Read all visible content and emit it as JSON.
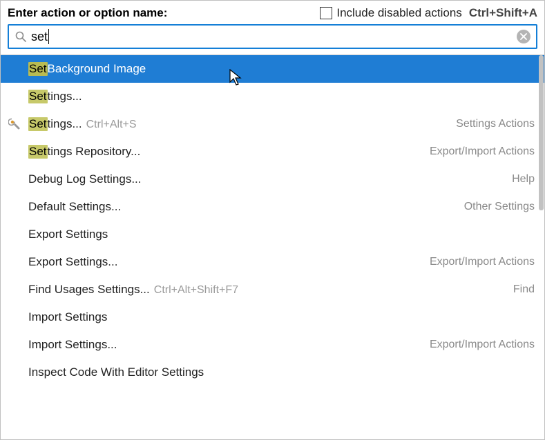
{
  "header": {
    "prompt": "Enter action or option name:",
    "checkbox_label": "Include disabled actions",
    "shortcut": "Ctrl+Shift+A"
  },
  "search": {
    "value": "set"
  },
  "results": [
    {
      "highlight": "Set",
      "rest": " Background Image",
      "shortcut": "",
      "category": "",
      "selected": true,
      "icon": ""
    },
    {
      "highlight": "Set",
      "rest": "tings...",
      "shortcut": "",
      "category": "",
      "selected": false,
      "icon": ""
    },
    {
      "highlight": "Set",
      "rest": "tings...",
      "shortcut": "Ctrl+Alt+S",
      "category": "Settings Actions",
      "selected": false,
      "icon": "wrench"
    },
    {
      "highlight": "Set",
      "rest": "tings Repository...",
      "shortcut": "",
      "category": "Export/Import Actions",
      "selected": false,
      "icon": ""
    },
    {
      "highlight": "",
      "rest": "Debug Log Settings...",
      "shortcut": "",
      "category": "Help",
      "selected": false,
      "icon": ""
    },
    {
      "highlight": "",
      "rest": "Default Settings...",
      "shortcut": "",
      "category": "Other Settings",
      "selected": false,
      "icon": ""
    },
    {
      "highlight": "",
      "rest": "Export Settings",
      "shortcut": "",
      "category": "",
      "selected": false,
      "icon": ""
    },
    {
      "highlight": "",
      "rest": "Export Settings...",
      "shortcut": "",
      "category": "Export/Import Actions",
      "selected": false,
      "icon": ""
    },
    {
      "highlight": "",
      "rest": "Find Usages Settings...",
      "shortcut": "Ctrl+Alt+Shift+F7",
      "category": "Find",
      "selected": false,
      "icon": ""
    },
    {
      "highlight": "",
      "rest": "Import Settings",
      "shortcut": "",
      "category": "",
      "selected": false,
      "icon": ""
    },
    {
      "highlight": "",
      "rest": "Import Settings...",
      "shortcut": "",
      "category": "Export/Import Actions",
      "selected": false,
      "icon": ""
    },
    {
      "highlight": "",
      "rest": "Inspect Code With Editor Settings",
      "shortcut": "",
      "category": "",
      "selected": false,
      "icon": ""
    }
  ]
}
